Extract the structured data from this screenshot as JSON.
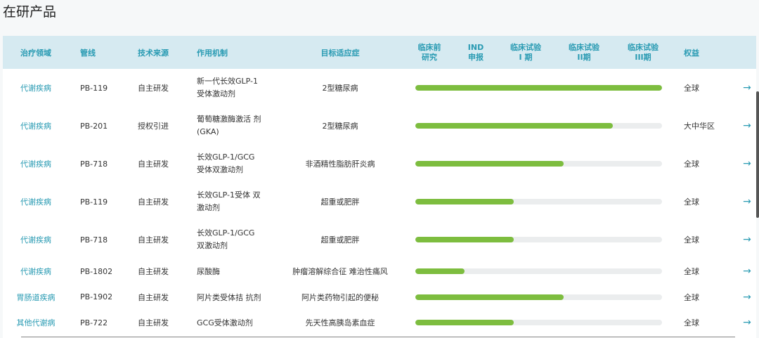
{
  "page_title": "在研产品",
  "headers": {
    "area": "治疗领域",
    "pipeline": "管线",
    "source": "技术来源",
    "mechanism": "作用机制",
    "indication": "目标适应症",
    "preclinical_1": "临床前",
    "preclinical_2": "研究",
    "ind_1": "IND",
    "ind_2": "申报",
    "phase1_1": "临床试验",
    "phase1_2": "I 期",
    "phase2_1": "临床试验",
    "phase2_2": "II期",
    "phase3_1": "临床试验",
    "phase3_2": "III期",
    "rights": "权益"
  },
  "rows": [
    {
      "area": "代谢疾病",
      "pipeline": "PB-119",
      "source": "自主研发",
      "mech1": "新一代长效GLP-1",
      "mech2": "受体激动剂",
      "indication": "2型糖尿病",
      "progress": 1.0,
      "rights": "全球"
    },
    {
      "area": "代谢疾病",
      "pipeline": "PB-201",
      "source": "授权引进",
      "mech1": "葡萄糖激酶激活 剂",
      "mech2": "(GKA)",
      "indication": "2型糖尿病",
      "progress": 0.8,
      "rights": "大中华区"
    },
    {
      "area": "代谢疾病",
      "pipeline": "PB-718",
      "source": "自主研发",
      "mech1": "长效GLP-1/GCG",
      "mech2": "受体双激动剂",
      "indication": "非酒精性脂肪肝炎病",
      "progress": 0.6,
      "rights": "全球"
    },
    {
      "area": "代谢疾病",
      "pipeline": "PB-119",
      "source": "自主研发",
      "mech1": "长效GLP-1受体 双",
      "mech2": "激动剂",
      "indication": "超重或肥胖",
      "progress": 0.4,
      "rights": "全球"
    },
    {
      "area": "代谢疾病",
      "pipeline": "PB-718",
      "source": "自主研发",
      "mech1": "长效GLP-1/GCG",
      "mech2": "双激动剂",
      "indication": "超重或肥胖",
      "progress": 0.4,
      "rights": "全球"
    },
    {
      "area": "代谢疾病",
      "pipeline": "PB-1802",
      "source": "自主研发",
      "mech1": "尿酸酶",
      "mech2": "",
      "indication": "肿瘤溶解综合征 难治性痛风",
      "progress": 0.2,
      "rights": "全球"
    },
    {
      "area": "胃肠道疾病",
      "pipeline": "PB-1902",
      "source": "自主研发",
      "mech1": "阿片类受体拮 抗剂",
      "mech2": "",
      "indication": "阿片类药物引起的便秘",
      "progress": 0.6,
      "rights": "全球"
    },
    {
      "area": "其他代谢病",
      "pipeline": "PB-722",
      "source": "自主研发",
      "mech1": "GCG受体激动剂",
      "mech2": "",
      "indication": "先天性高胰岛素血症",
      "progress": 0.4,
      "rights": "全球"
    }
  ],
  "icons": {
    "row_link": "arrow-right-icon"
  },
  "colors": {
    "accent": "#2a9bb3",
    "progress_fill": "#7dbd3f",
    "progress_track": "#ebedee",
    "header_bg": "#d6eaf1"
  }
}
